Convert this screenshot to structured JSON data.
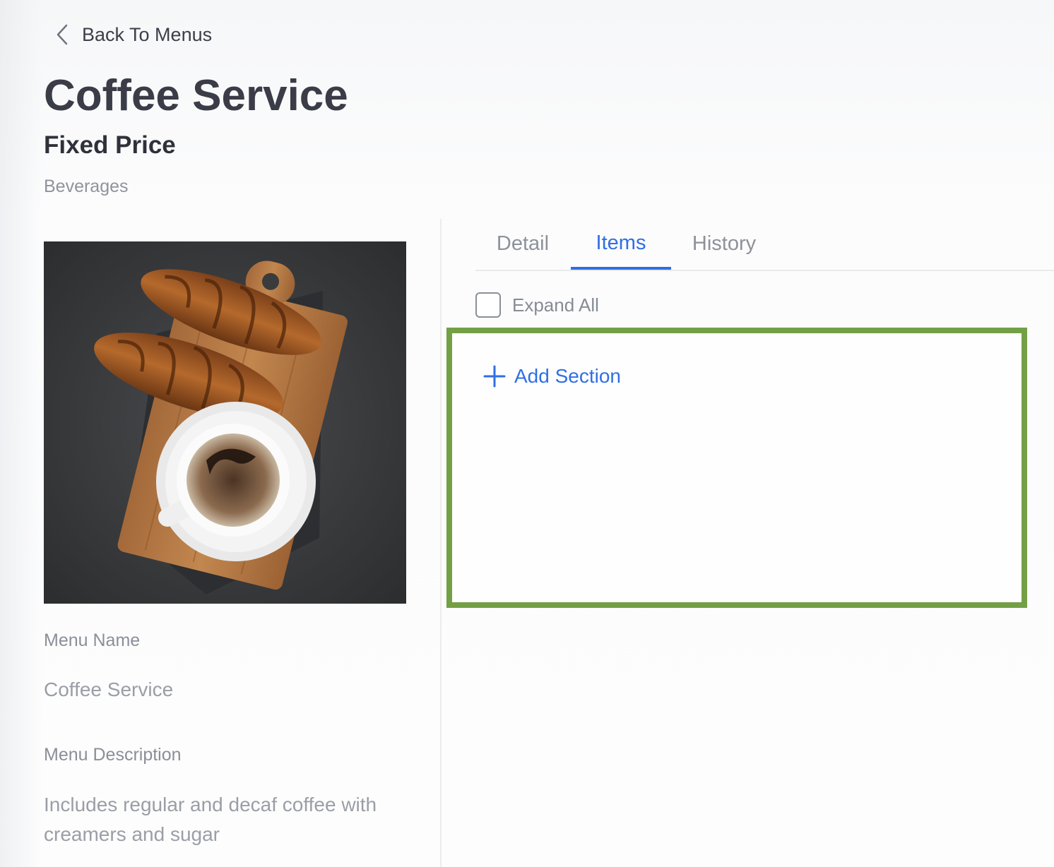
{
  "nav": {
    "back_label": "Back To Menus"
  },
  "header": {
    "title": "Coffee Service",
    "subtitle": "Fixed Price",
    "category": "Beverages"
  },
  "details": {
    "name_label": "Menu Name",
    "name_value": "Coffee Service",
    "description_label": "Menu Description",
    "description_value": "Includes regular and decaf coffee with creamers and sugar"
  },
  "tabs": [
    {
      "label": "Detail",
      "active": false
    },
    {
      "label": "Items",
      "active": true
    },
    {
      "label": "History",
      "active": false
    }
  ],
  "items_panel": {
    "expand_all_label": "Expand All",
    "expand_all_checked": false,
    "add_section_label": "Add Section"
  },
  "colors": {
    "accent": "#2f6fe4",
    "highlight_border": "#73a045",
    "title_text": "#3a3d48",
    "muted_text": "#8f949c"
  },
  "icons": {
    "back": "chevron-left-icon",
    "add": "plus-icon"
  }
}
